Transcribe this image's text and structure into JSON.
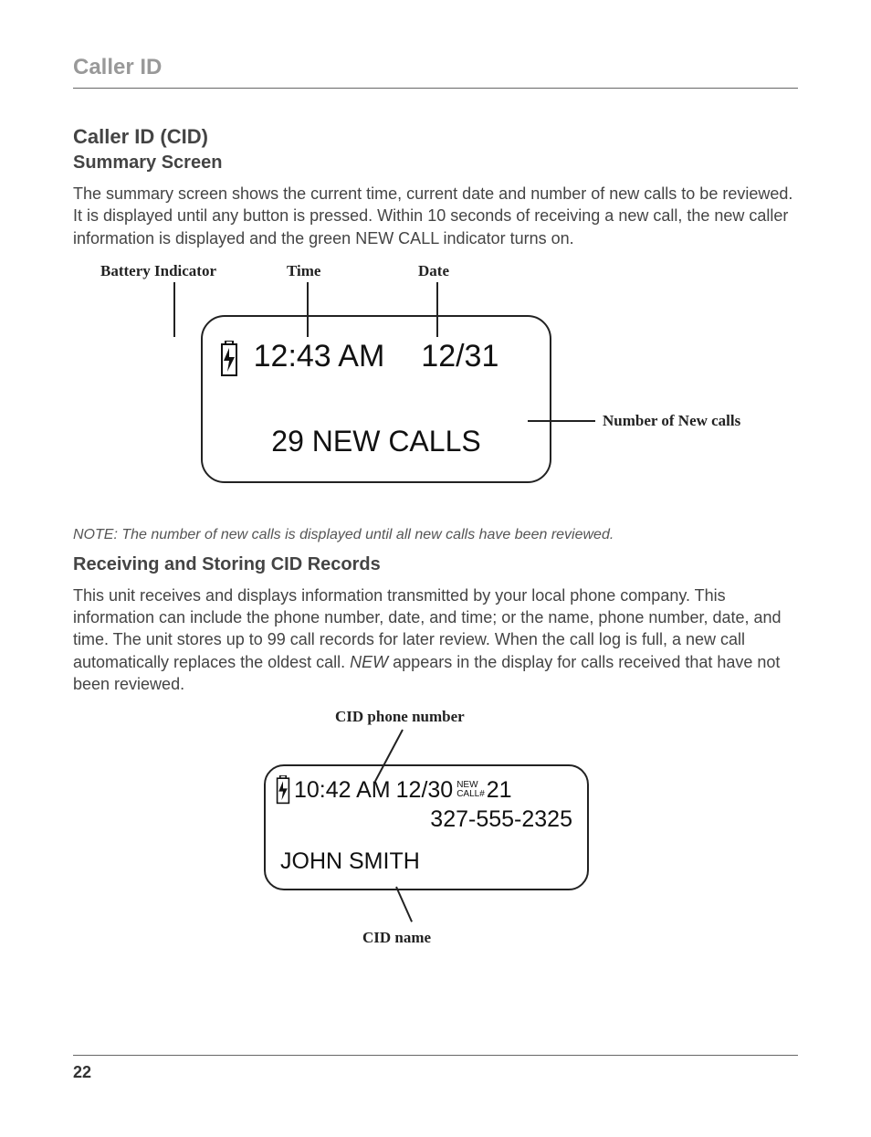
{
  "section_header": "Caller ID",
  "heading1": "Caller ID (CID)",
  "heading2": "Summary Screen",
  "para1": "The summary screen shows the current time, current date and number of new calls to be reviewed. It is displayed until any button is pressed. Within 10 seconds of receiving a new call, the new caller information is displayed and the green NEW CALL indicator turns on.",
  "fig1": {
    "label_battery": "Battery Indicator",
    "label_time": "Time",
    "label_date": "Date",
    "label_newcalls": "Number of New calls",
    "time": "12:43 AM",
    "date": "12/31",
    "newcalls": "29 NEW CALLS"
  },
  "note": "NOTE: The number of new calls is displayed until all new calls have been reviewed.",
  "heading3": "Receiving and Storing CID Records",
  "para2_part1": "This unit receives and displays information transmitted by your local phone company. This information can include the phone number, date, and time; or the name, phone number, date, and time. The unit stores up to 99 call records for later review. When the call log is full, a new call automatically replaces the oldest call. ",
  "para2_italic": "NEW",
  "para2_part2": " appears in the display for calls received that have not been reviewed.",
  "fig2": {
    "label_phone": "CID phone number",
    "label_name": "CID name",
    "time": "10:42 AM",
    "date": "12/30",
    "small_new": "NEW",
    "small_call": "CALL#",
    "count": "21",
    "phone": "327-555-2325",
    "name": "JOHN SMITH"
  },
  "page_number": "22"
}
